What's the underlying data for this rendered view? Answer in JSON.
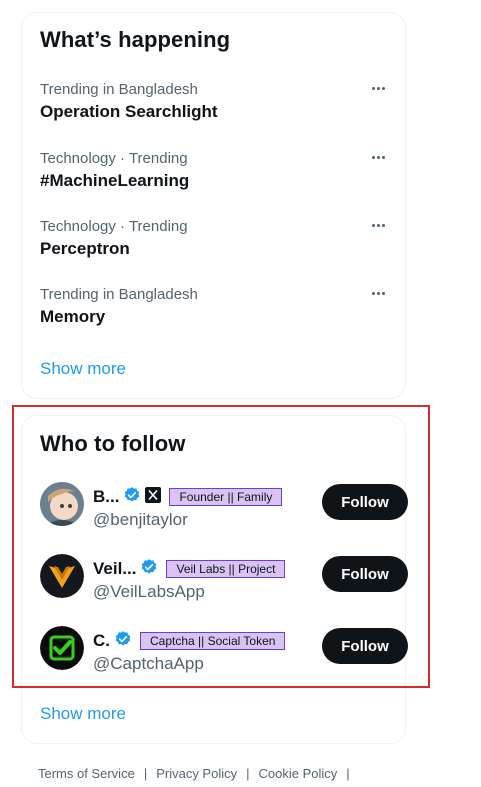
{
  "whats_happening": {
    "title": "What’s happening",
    "trends": [
      {
        "meta": "Trending in Bangladesh",
        "name": "Operation Searchlight"
      },
      {
        "meta": "Technology · Trending",
        "name": "#MachineLearning"
      },
      {
        "meta": "Technology · Trending",
        "name": "Perceptron"
      },
      {
        "meta": "Trending in Bangladesh",
        "name": "Memory"
      }
    ],
    "show_more": "Show more"
  },
  "who_to_follow": {
    "title": "Who to follow",
    "accounts": [
      {
        "name": "B...",
        "handle": "@benjitaylor",
        "badge": "Founder || Family",
        "button": "Follow"
      },
      {
        "name": "Veil...",
        "handle": "@VeilLabsApp",
        "badge": "Veil Labs || Project",
        "button": "Follow"
      },
      {
        "name": "C.",
        "handle": "@CaptchaApp",
        "badge": "Captcha || Social Token",
        "button": "Follow"
      }
    ],
    "show_more": "Show more"
  },
  "footer": {
    "links": [
      "Terms of Service",
      "Privacy Policy",
      "Cookie Policy"
    ],
    "separator": "|"
  },
  "colors": {
    "accent": "#1d9bf0",
    "text_primary": "#0f1419",
    "text_secondary": "#536471",
    "badge_bg": "#d9c3f2",
    "highlight": "#d92b2b"
  },
  "icons": {
    "verified": "verified-badge-icon",
    "x_logo": "x-logo-icon",
    "more": "more-dots-icon"
  }
}
